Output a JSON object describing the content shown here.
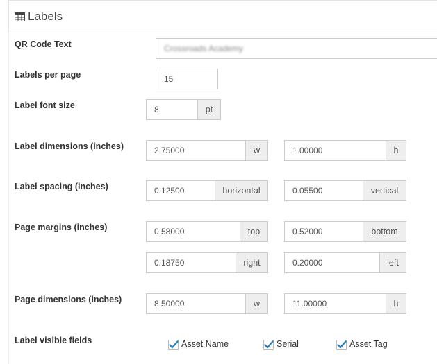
{
  "panel": {
    "title": "Labels",
    "icon": "table-icon"
  },
  "qr": {
    "label": "QR Code Text",
    "value": "Crossroads Academy"
  },
  "labels_per_page": {
    "label": "Labels per page",
    "value": "15"
  },
  "font_size": {
    "label": "Label font size",
    "value": "8",
    "unit": "pt"
  },
  "label_dimensions": {
    "label": "Label dimensions (inches)",
    "w": "2.75000",
    "w_unit": "w",
    "h": "1.00000",
    "h_unit": "h"
  },
  "label_spacing": {
    "label": "Label spacing (inches)",
    "horizontal": "0.12500",
    "horizontal_unit": "horizontal",
    "vertical": "0.05500",
    "vertical_unit": "vertical"
  },
  "page_margins": {
    "label": "Page margins (inches)",
    "top": "0.58000",
    "top_unit": "top",
    "bottom": "0.52000",
    "bottom_unit": "bottom",
    "right": "0.18750",
    "right_unit": "right",
    "left": "0.20000",
    "left_unit": "left"
  },
  "page_dimensions": {
    "label": "Page dimensions (inches)",
    "w": "8.50000",
    "w_unit": "w",
    "h": "11.00000",
    "h_unit": "h"
  },
  "visible_fields": {
    "label": "Label visible fields",
    "items": [
      {
        "label": "Asset Name",
        "checked": true
      },
      {
        "label": "Serial",
        "checked": true
      },
      {
        "label": "Asset Tag",
        "checked": true
      }
    ]
  },
  "colors": {
    "check": "#2c7fb8",
    "border": "#cccccc",
    "addon_bg": "#eeeeee"
  }
}
